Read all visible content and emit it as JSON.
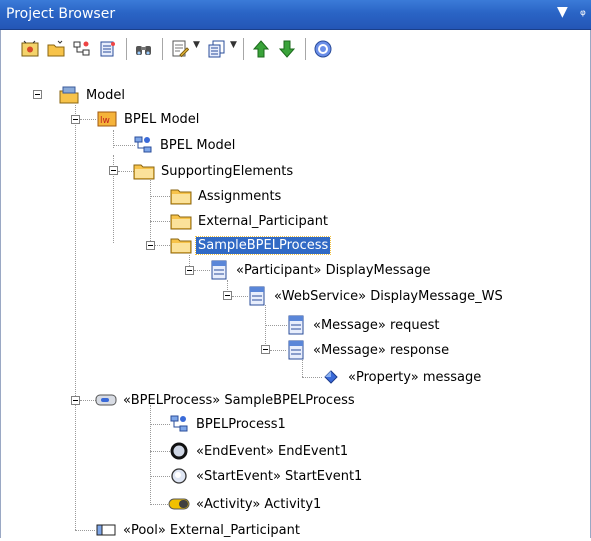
{
  "panel": {
    "title": "Project Browser",
    "pin_glyph": "▼",
    "close_glyph": "ᵩ"
  },
  "toolbar": {
    "buttons": [
      {
        "icon": "new-model-icon"
      },
      {
        "icon": "new-package-icon"
      },
      {
        "icon": "new-diagram-icon"
      },
      {
        "icon": "new-element-icon"
      },
      {
        "icon": "find-icon"
      },
      {
        "icon": "properties-icon"
      },
      {
        "icon": "dropdown-arrow"
      },
      {
        "icon": "copy-icon"
      },
      {
        "icon": "dropdown-arrow"
      },
      {
        "icon": "move-up-icon"
      },
      {
        "icon": "move-down-icon"
      },
      {
        "icon": "help-icon"
      }
    ]
  },
  "tree": [
    {
      "label": "Model",
      "icon": "model-root-icon"
    },
    {
      "label": "BPEL Model",
      "icon": "bpel-package-icon"
    },
    {
      "label": "BPEL Model",
      "icon": "bpel-diagram-icon"
    },
    {
      "label": "SupportingElements",
      "icon": "folder-icon"
    },
    {
      "label": "Assignments",
      "icon": "folder-icon"
    },
    {
      "label": "External_Participant",
      "icon": "folder-icon"
    },
    {
      "label": "SampleBPELProcess",
      "icon": "folder-icon",
      "selected": true
    },
    {
      "label": "«Participant» DisplayMessage",
      "icon": "class-icon"
    },
    {
      "label": "«WebService» DisplayMessage_WS",
      "icon": "class-icon"
    },
    {
      "label": "«Message» request",
      "icon": "class-icon"
    },
    {
      "label": "«Message» response",
      "icon": "class-icon"
    },
    {
      "label": "«Property» message",
      "icon": "property-icon"
    },
    {
      "label": "«BPELProcess» SampleBPELProcess",
      "icon": "process-icon"
    },
    {
      "label": "BPELProcess1",
      "icon": "bpel-diagram-icon"
    },
    {
      "label": "«EndEvent» EndEvent1",
      "icon": "end-event-icon"
    },
    {
      "label": "«StartEvent» StartEvent1",
      "icon": "start-event-icon"
    },
    {
      "label": "«Activity» Activity1",
      "icon": "activity-icon"
    },
    {
      "label": "«Pool» External_Participant",
      "icon": "pool-icon"
    }
  ],
  "colors": {
    "title_bar": "#2a64c5",
    "selection": "#316ac5",
    "folder": "#f7c34a"
  }
}
